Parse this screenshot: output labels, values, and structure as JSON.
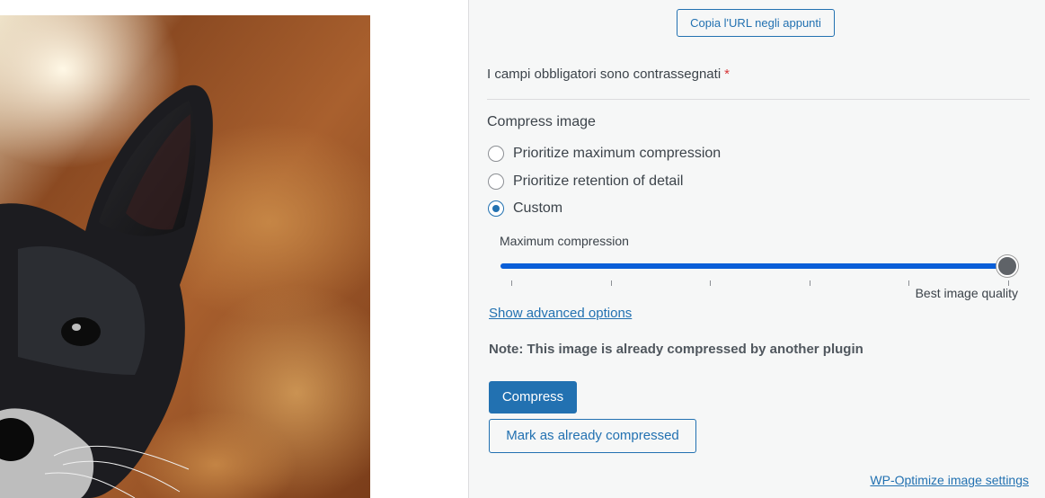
{
  "preview": {
    "image_subject": "black-dog-photo"
  },
  "panel": {
    "copy_url_label": "Copia l'URL negli appunti",
    "required_note": "I campi obbligatori sono contrassegnati",
    "required_star": "*",
    "compress_section": {
      "title": "Compress image",
      "options": [
        {
          "label": "Prioritize maximum compression",
          "checked": false
        },
        {
          "label": "Prioritize retention of detail",
          "checked": false
        },
        {
          "label": "Custom",
          "checked": true
        }
      ]
    },
    "slider": {
      "min_label": "Maximum compression",
      "max_label": "Best image quality",
      "value_fraction": 1.0,
      "tick_count": 6
    },
    "advanced_link": "Show advanced options",
    "note": "Note: This image is already compressed by another plugin",
    "compress_button": "Compress",
    "mark_button": "Mark as already compressed",
    "settings_link": "WP-Optimize image settings"
  },
  "colors": {
    "accent": "#2271b1",
    "slider_fill": "#0a5fd8",
    "required": "#d63638",
    "panel_bg": "#f6f7f7"
  }
}
